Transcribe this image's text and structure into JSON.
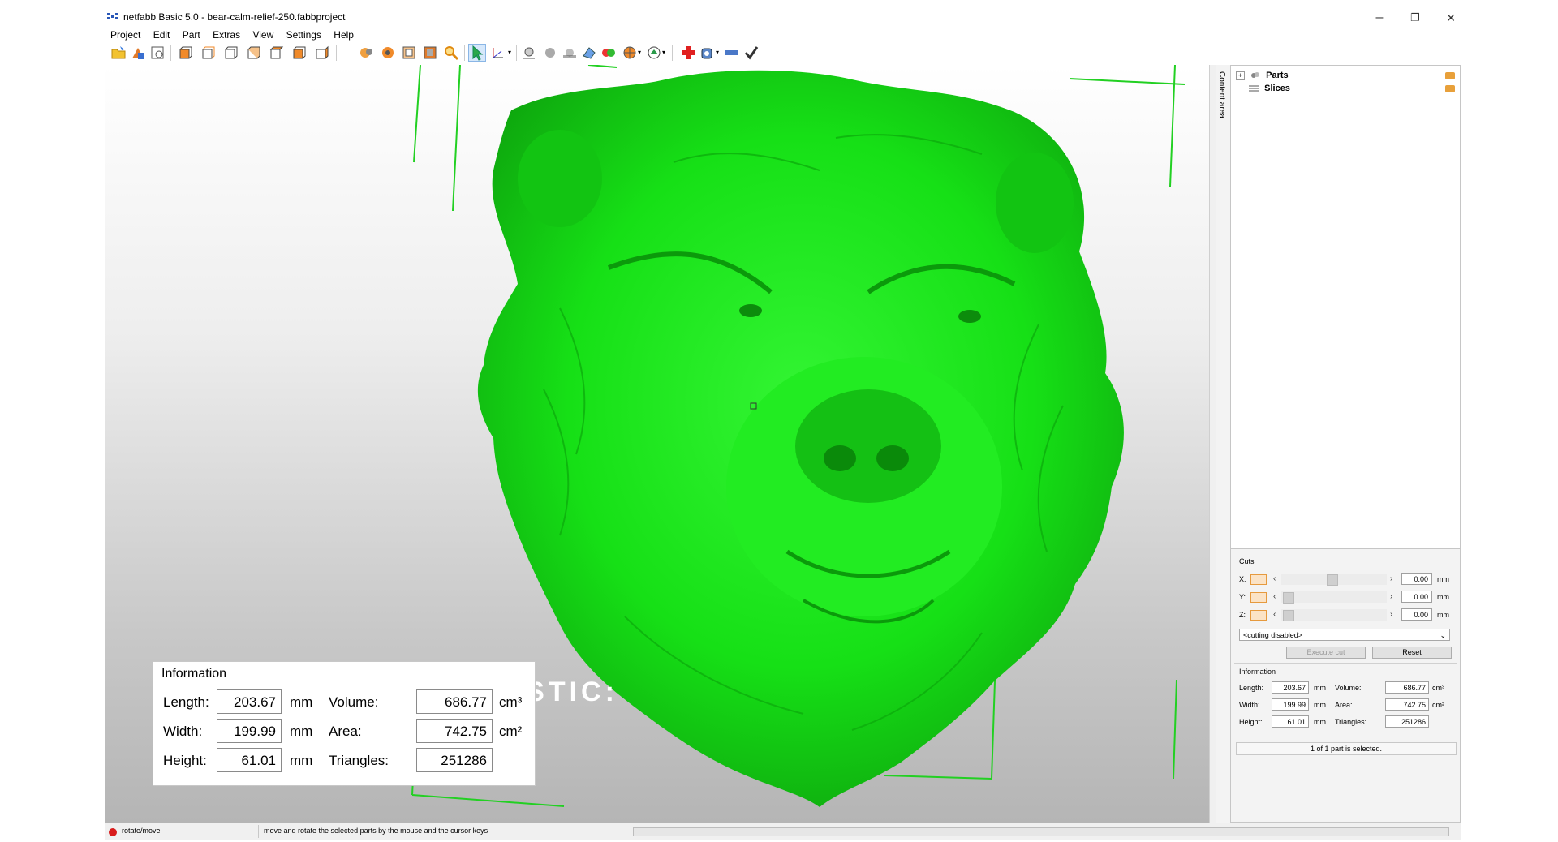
{
  "window": {
    "title": "netfabb Basic 5.0 - bear-calm-relief-250.fabbproject",
    "controls": {
      "minimize": "–",
      "maximize": "❐",
      "close": "✕"
    }
  },
  "menu": [
    "Project",
    "Edit",
    "Part",
    "Extras",
    "View",
    "Settings",
    "Help"
  ],
  "toolbar": {
    "icons": [
      "open-project-icon",
      "add-part-icon",
      "save-icon",
      "view-front-icon",
      "view-back-icon",
      "view-left-icon",
      "view-right-icon",
      "view-top-icon",
      "view-bottom-icon",
      "rotate-view-icon",
      "zoom-all-icon",
      "zoom-selection-icon",
      "zoom-part-icon",
      "zoom-icon",
      "select-cursor-icon",
      "measure-axes-icon",
      "shading-icon",
      "material-icon",
      "slices-icon",
      "mesh-icon",
      "color-icon",
      "globe-icon",
      "repair-view-icon",
      "repair-cross-icon",
      "analysis-icon",
      "ruler-icon",
      "checkmark-icon"
    ]
  },
  "overlay": {
    "heading": "NETFABB STATISTIC:",
    "panel_title": "Information",
    "length_label": "Length:",
    "length_value": "203.67",
    "length_unit": "mm",
    "width_label": "Width:",
    "width_value": "199.99",
    "width_unit": "mm",
    "height_label": "Height:",
    "height_value": "61.01",
    "height_unit": "mm",
    "volume_label": "Volume:",
    "volume_value": "686.77",
    "volume_unit": "cm³",
    "area_label": "Area:",
    "area_value": "742.75",
    "area_unit": "cm²",
    "triangles_label": "Triangles:",
    "triangles_value": "251286"
  },
  "side": {
    "content_tab": "Content area",
    "tree": [
      "Parts",
      "Slices"
    ],
    "cuts": {
      "title": "Cuts",
      "x_label": "X:",
      "y_label": "Y:",
      "z_label": "Z:",
      "x_value": "0.00",
      "y_value": "0.00",
      "z_value": "0.00",
      "unit": "mm",
      "mode": "<cutting disabled>",
      "execute": "Execute cut",
      "reset": "Reset"
    },
    "info": {
      "title": "Information",
      "length_label": "Length:",
      "length_value": "203.67",
      "width_label": "Width:",
      "width_value": "199.99",
      "height_label": "Height:",
      "height_value": "61.01",
      "mm": "mm",
      "volume_label": "Volume:",
      "volume_value": "686.77",
      "volume_unit": "cm³",
      "area_label": "Area:",
      "area_value": "742.75",
      "area_unit": "cm²",
      "triangles_label": "Triangles:",
      "triangles_value": "251286"
    },
    "selected": "1 of 1 part is selected."
  },
  "status": {
    "mode": "rotate/move",
    "hint": "move and rotate the selected parts by the mouse and the cursor keys"
  },
  "colors": {
    "model": "#17e317",
    "bbox": "#22d022",
    "status_dot": "#d81b1b"
  }
}
